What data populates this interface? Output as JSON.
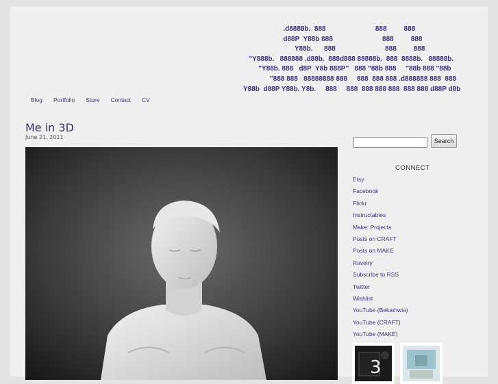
{
  "header": {
    "ascii_logo": "                     .d8888b.  888                          888         888\n                     d88P  Y88b 888                          888         888\n                           Y88b.      888                          888         888\n   \"Y888b.   888888 .d88b.  888d888 88888b.  888  8888b.   88888b.\n        \"Y88b. 888   d8P  Y8b 888P\"   888 \"88b 888     \"88b 888 \"88b\n              \"888 888   88888888 888     888  888 888 .d888888 888  888\nY88b  d88P Y88b. Y8b.     888     888  888 888 888  888 888 d88P d8b"
  },
  "nav": {
    "items": [
      "Blog",
      "Portfolio",
      "Store",
      "Contact",
      "CV"
    ]
  },
  "post": {
    "title": "Me in 3D",
    "date": "June 21, 2011",
    "image_desc": "3d-printed-bust"
  },
  "sidebar": {
    "search_placeholder": "",
    "search_button": "Search",
    "connect_heading": "CONNECT",
    "links": [
      "Etsy",
      "Facebook",
      "Flickr",
      "Instructables",
      "Make: Projects",
      "Posts on CRAFT",
      "Posts on MAKE",
      "Ravelry",
      "Subscribe to RSS",
      "Twitter",
      "Wishlist",
      "YouTube (Bekathwia)",
      "YouTube (CRAFT)",
      "YouTube (MAKE)"
    ]
  },
  "colors": {
    "page_bg": "#efefef",
    "outer_bg": "#e4e4e4",
    "link": "#40367a",
    "logo": "#3f2f78"
  }
}
